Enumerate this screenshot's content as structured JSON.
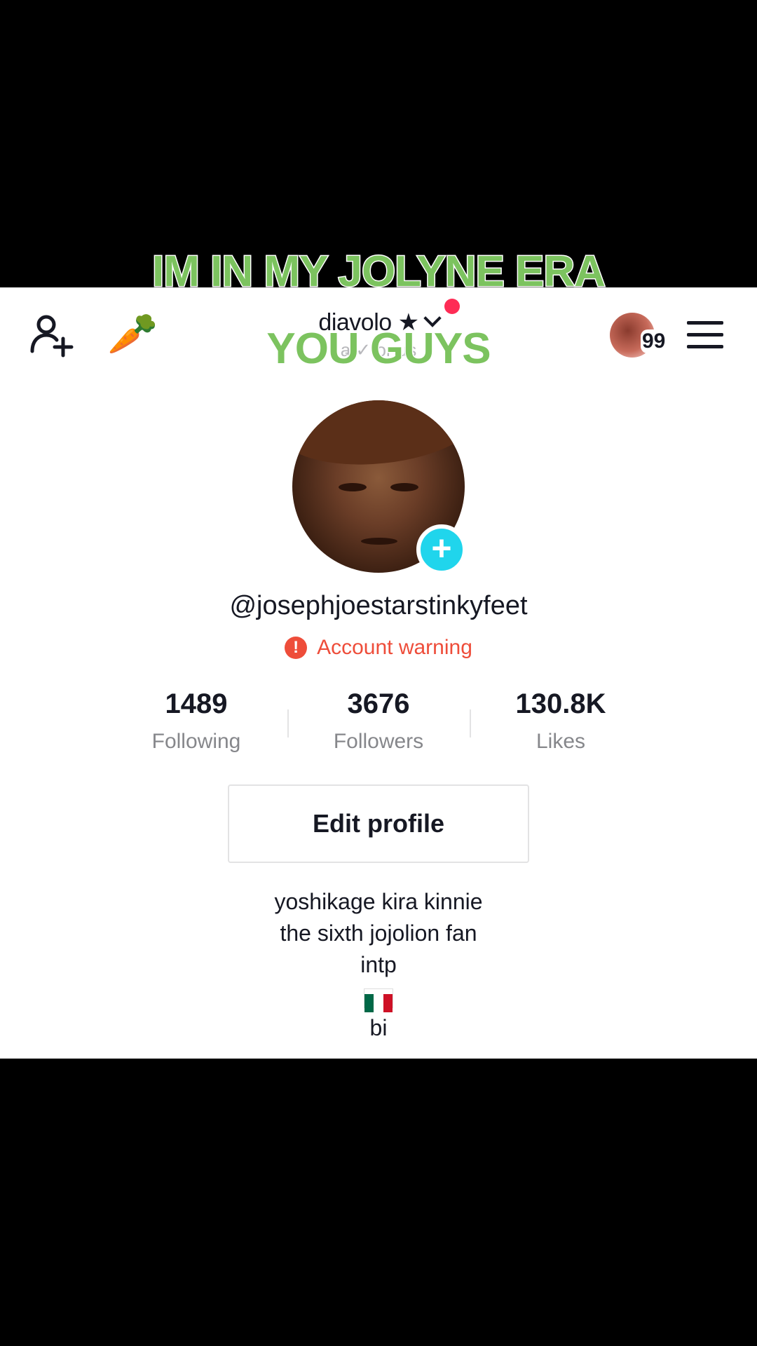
{
  "overlay": {
    "caption_line1": "IM IN MY JOLYNE ERA",
    "caption_line2": "YOU GUYS",
    "color": "#7cc35f"
  },
  "top_bar": {
    "add_friend_icon": "add-user-icon",
    "emoji": "🥕",
    "account_name": "diavolo ★",
    "account_subline": "a̶ ✓ or  us",
    "story_badge_count": "99",
    "menu_icon": "hamburger-menu-icon"
  },
  "profile": {
    "handle": "@josephjoestarstinkyfeet",
    "warning": "Account warning",
    "warning_color": "#ee4d3a"
  },
  "stats": [
    {
      "value": "1489",
      "label": "Following"
    },
    {
      "value": "3676",
      "label": "Followers"
    },
    {
      "value": "130.8K",
      "label": "Likes"
    }
  ],
  "edit_button": "Edit profile",
  "bio": {
    "line1": "yoshikage kira kinnie",
    "line2": "the sixth jojolion fan",
    "line3": "intp",
    "line4_flag": "mexico-flag",
    "line5": "bi"
  },
  "colors": {
    "accent_plus": "#20d5ec",
    "notification_dot": "#fe2c55"
  }
}
